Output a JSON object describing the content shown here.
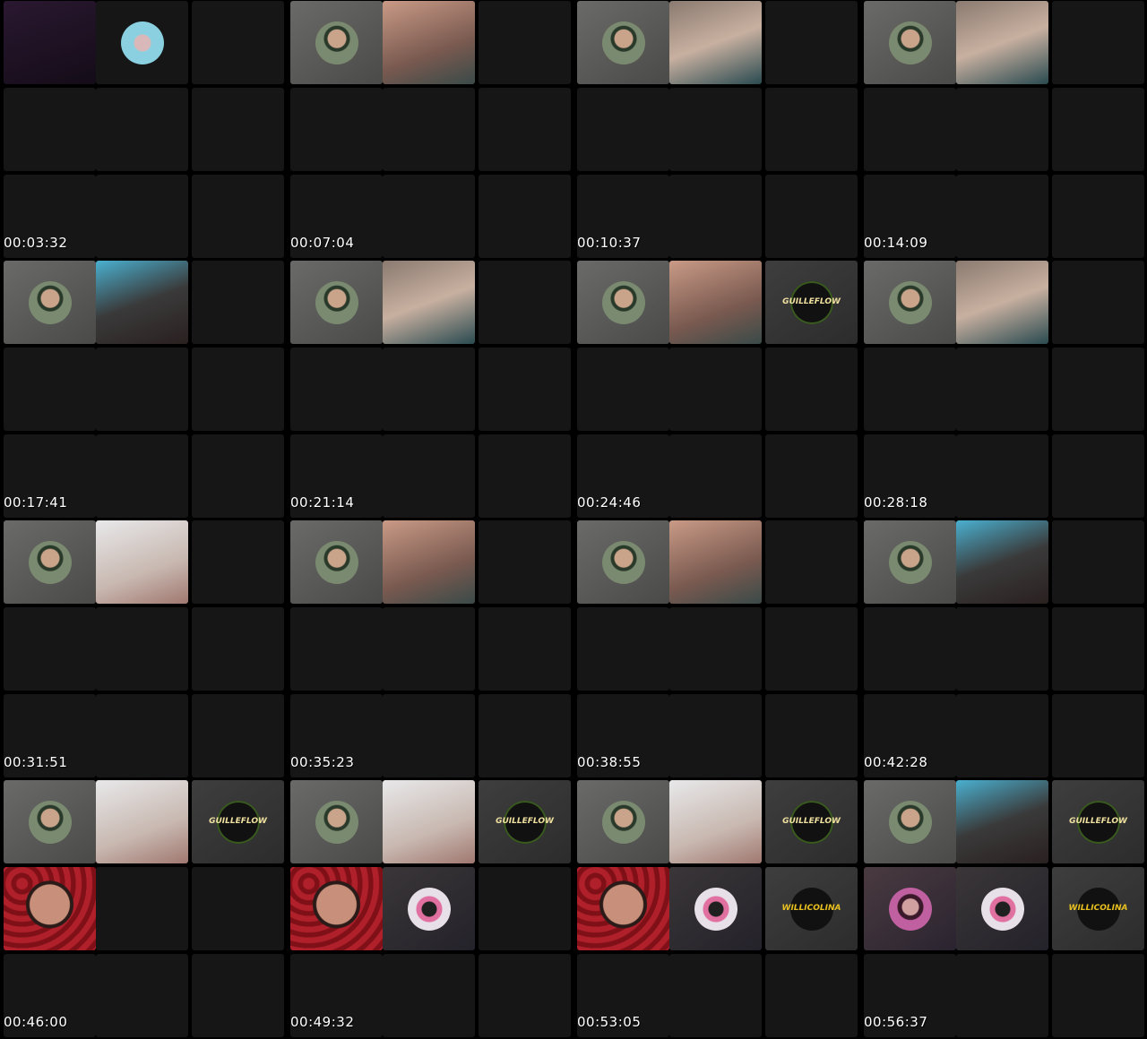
{
  "frames": [
    {
      "timestamp": "00:03:32",
      "tiles": [
        [
          "video-purple",
          "avatar-blue",
          "empty"
        ],
        [
          "empty",
          "empty",
          "empty"
        ],
        [
          "empty",
          "empty",
          "empty"
        ]
      ]
    },
    {
      "timestamp": "00:07:04",
      "tiles": [
        [
          "avatar-user",
          "video-face",
          "empty"
        ],
        [
          "empty",
          "empty",
          "empty"
        ],
        [
          "empty",
          "empty",
          "empty"
        ]
      ]
    },
    {
      "timestamp": "00:10:37",
      "tiles": [
        [
          "avatar-user",
          "video-sleep",
          "empty"
        ],
        [
          "empty",
          "empty",
          "empty"
        ],
        [
          "empty",
          "empty",
          "empty"
        ]
      ]
    },
    {
      "timestamp": "00:14:09",
      "tiles": [
        [
          "avatar-user",
          "video-sleep",
          "empty"
        ],
        [
          "empty",
          "empty",
          "empty"
        ],
        [
          "empty",
          "empty",
          "empty"
        ]
      ]
    },
    {
      "timestamp": "00:17:41",
      "tiles": [
        [
          "avatar-user",
          "video-room",
          "empty"
        ],
        [
          "empty",
          "empty",
          "empty"
        ],
        [
          "empty",
          "empty",
          "empty"
        ]
      ]
    },
    {
      "timestamp": "00:21:14",
      "tiles": [
        [
          "avatar-user",
          "video-sleep",
          "empty"
        ],
        [
          "empty",
          "empty",
          "empty"
        ],
        [
          "empty",
          "empty",
          "empty"
        ]
      ]
    },
    {
      "timestamp": "00:24:46",
      "tiles": [
        [
          "avatar-user",
          "video-face",
          "logo-guille"
        ],
        [
          "empty",
          "empty",
          "empty"
        ],
        [
          "empty",
          "empty",
          "empty"
        ]
      ]
    },
    {
      "timestamp": "00:28:18",
      "tiles": [
        [
          "avatar-user",
          "video-sleep",
          "empty"
        ],
        [
          "empty",
          "empty",
          "empty"
        ],
        [
          "empty",
          "empty",
          "empty"
        ]
      ]
    },
    {
      "timestamp": "00:31:51",
      "tiles": [
        [
          "avatar-user",
          "video-bright",
          "empty"
        ],
        [
          "empty",
          "empty",
          "empty"
        ],
        [
          "empty",
          "empty",
          "empty"
        ]
      ]
    },
    {
      "timestamp": "00:35:23",
      "tiles": [
        [
          "avatar-user",
          "video-face",
          "empty"
        ],
        [
          "empty",
          "empty",
          "empty"
        ],
        [
          "empty",
          "empty",
          "empty"
        ]
      ]
    },
    {
      "timestamp": "00:38:55",
      "tiles": [
        [
          "avatar-user",
          "video-face",
          "empty"
        ],
        [
          "empty",
          "empty",
          "empty"
        ],
        [
          "empty",
          "empty",
          "empty"
        ]
      ]
    },
    {
      "timestamp": "00:42:28",
      "tiles": [
        [
          "avatar-user",
          "video-room",
          "empty"
        ],
        [
          "empty",
          "empty",
          "empty"
        ],
        [
          "empty",
          "empty",
          "empty"
        ]
      ]
    },
    {
      "timestamp": "00:46:00",
      "tiles": [
        [
          "avatar-user",
          "video-bright",
          "logo-guille"
        ],
        [
          "video-red",
          "empty",
          "empty"
        ],
        [
          "empty",
          "empty",
          "empty"
        ]
      ]
    },
    {
      "timestamp": "00:49:32",
      "tiles": [
        [
          "avatar-user",
          "video-bright",
          "logo-guille"
        ],
        [
          "video-red",
          "avatar-dark",
          "empty"
        ],
        [
          "empty",
          "empty",
          "empty"
        ]
      ]
    },
    {
      "timestamp": "00:53:05",
      "tiles": [
        [
          "avatar-user",
          "video-bright",
          "logo-guille"
        ],
        [
          "video-red",
          "avatar-dark",
          "logo-willi"
        ],
        [
          "empty",
          "empty",
          "empty"
        ]
      ]
    },
    {
      "timestamp": "00:56:37",
      "tiles": [
        [
          "avatar-user",
          "video-room",
          "logo-guille"
        ],
        [
          "avatar-user-pink",
          "avatar-dark",
          "logo-willi"
        ],
        [
          "empty",
          "empty",
          "empty"
        ]
      ]
    }
  ],
  "logos": {
    "guille": [
      "GUILLE",
      "FLOW"
    ],
    "willi": [
      "WILLI",
      "COLINA"
    ]
  },
  "colors": {
    "background": "#000000",
    "tile_empty": "#161616",
    "timestamp": "#ffffff"
  }
}
